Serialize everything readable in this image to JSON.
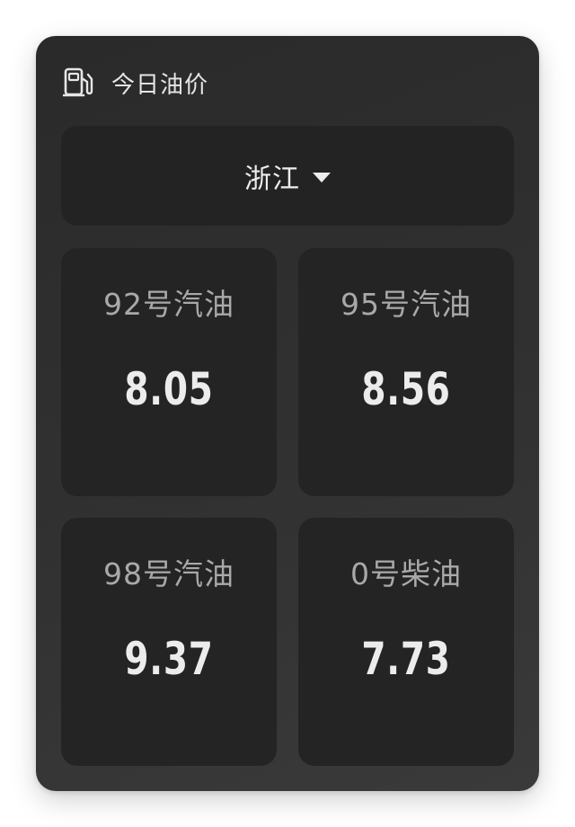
{
  "header": {
    "icon": "fuel-pump-icon",
    "title": "今日油价"
  },
  "region": {
    "selected": "浙江",
    "caret_icon": "caret-down-icon"
  },
  "prices": [
    {
      "name": "92号汽油",
      "value": "8.05"
    },
    {
      "name": "95号汽油",
      "value": "8.56"
    },
    {
      "name": "98号汽油",
      "value": "9.37"
    },
    {
      "name": "0号柴油",
      "value": "7.73"
    }
  ],
  "colors": {
    "card_background": "#242424",
    "widget_background": "#313131",
    "price_text": "#ececec",
    "label_text": "#a9a9a9"
  }
}
